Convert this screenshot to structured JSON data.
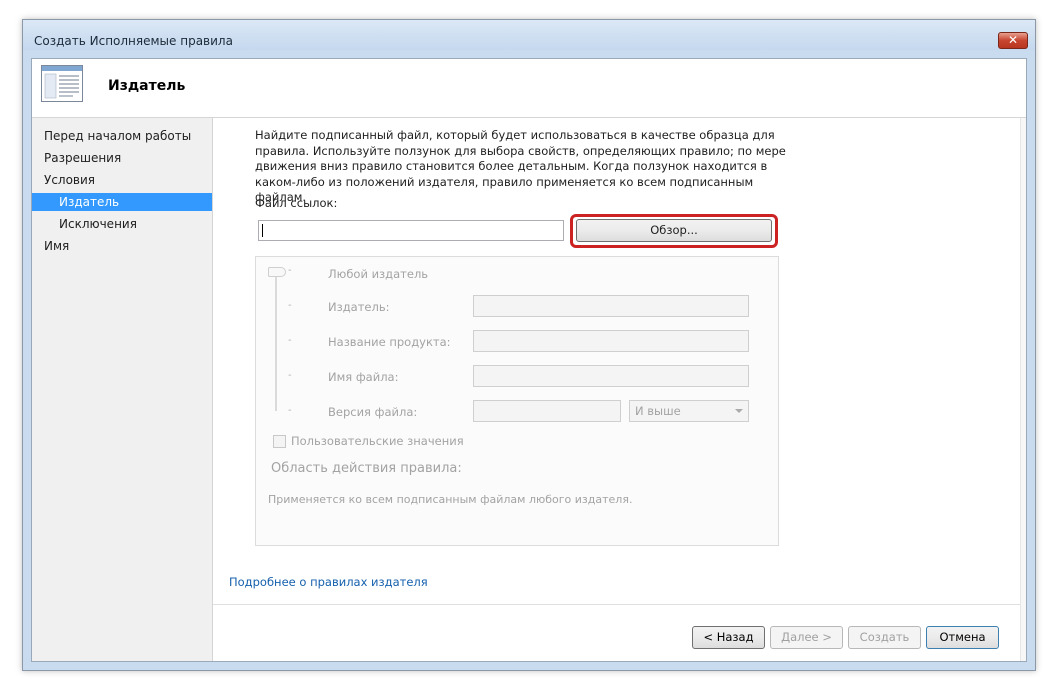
{
  "window": {
    "title": "Создать Исполняемые правила",
    "close_label": "✕"
  },
  "header": {
    "title": "Издатель",
    "icon": "wizard-page-icon"
  },
  "nav": {
    "items": [
      {
        "label": "Перед началом работы"
      },
      {
        "label": "Разрешения"
      },
      {
        "label": "Условия"
      },
      {
        "label": "Издатель",
        "selected": true
      },
      {
        "label": "Исключения"
      },
      {
        "label": "Имя"
      }
    ]
  },
  "main": {
    "description": "Найдите подписанный файл, который будет использоваться в качестве образца для правила. Используйте ползунок для выбора свойств, определяющих правило; по мере движения вниз правило становится более детальным. Когда ползунок находится в каком-либо из положений издателя, правило применяется ко всем подписанным файлам.",
    "file_label": "Файл ссылок:",
    "file_value": "",
    "browse_label": "Обзор...",
    "any_publisher": "Любой издатель",
    "publisher_label": "Издатель:",
    "product_label": "Название продукта:",
    "filename_label": "Имя файла:",
    "version_label": "Версия файла:",
    "version_option": "И выше",
    "custom_values_label": "Пользовательские значения",
    "scope_label": "Область действия правила:",
    "scope_text": "Применяется ко всем подписанным файлам любого издателя.",
    "link_text": "Подробнее о правилах издателя",
    "tick": "-"
  },
  "footer": {
    "back": "< Назад",
    "next": "Далее >",
    "create": "Создать",
    "cancel": "Отмена"
  },
  "colors": {
    "selected": "#3399ff",
    "link": "#1560ad",
    "highlight": "#cc2222"
  }
}
